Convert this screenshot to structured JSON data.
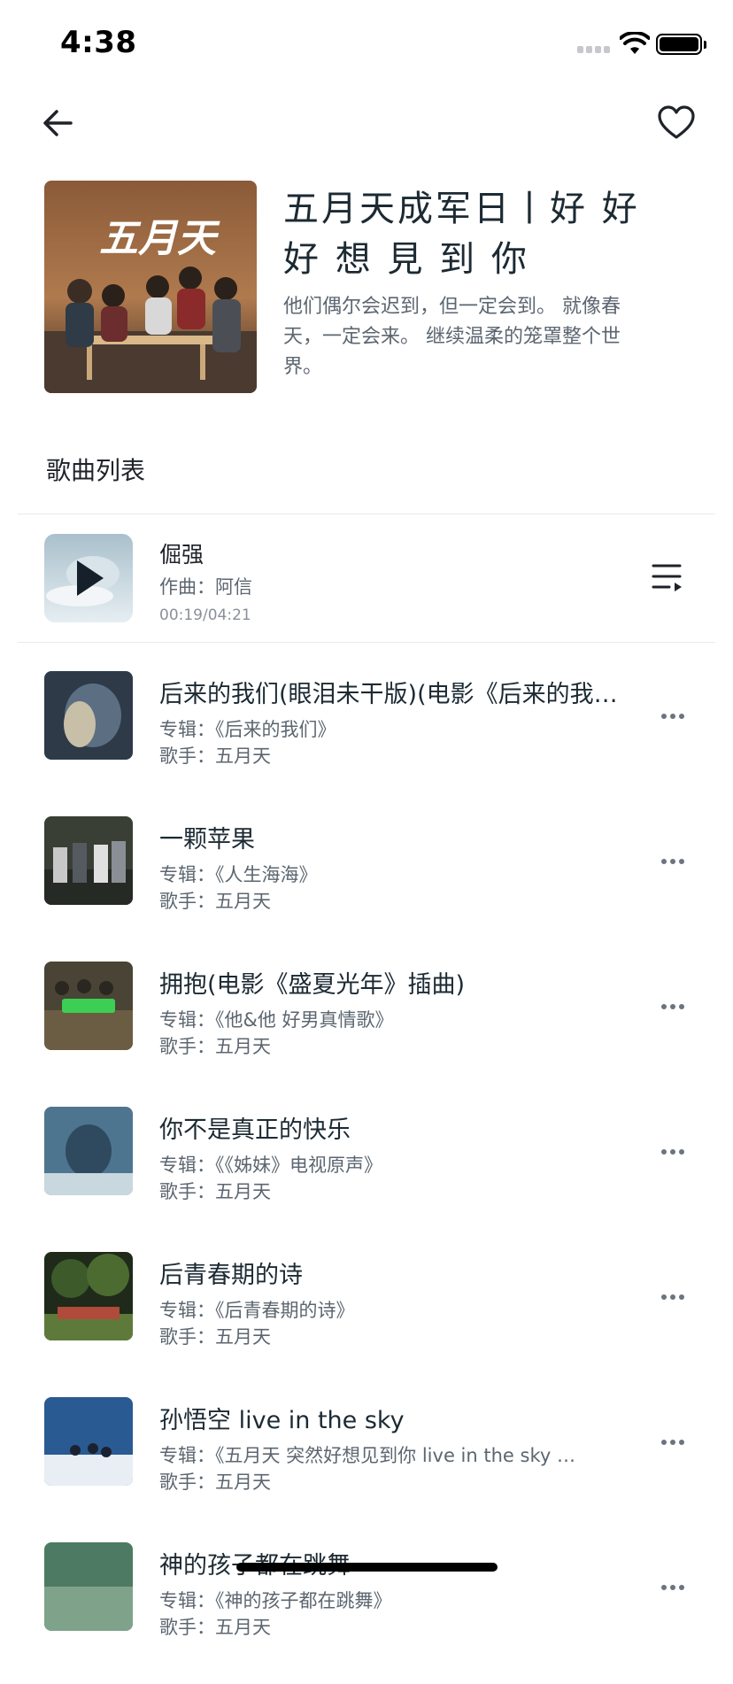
{
  "status_bar": {
    "time": "4:38"
  },
  "playlist": {
    "title": "五月天成军日丨好 好 好 想 見 到 你",
    "description": "他们偶尔会迟到，但一定会到。 就像春天，一定会来。 继续温柔的笼罩整个世界。",
    "cover_text": "五月天"
  },
  "list_heading": "歌曲列表",
  "now_playing": {
    "title": "倔强",
    "composer": "作曲：阿信",
    "progress": "00:19/04:21"
  },
  "songs": [
    {
      "title": "后来的我们(眼泪未干版)(电影《后来的我们》插曲)",
      "album": "专辑：《后来的我们》",
      "singer": "歌手：五月天"
    },
    {
      "title": "一颗苹果",
      "album": "专辑：《人生海海》",
      "singer": "歌手：五月天"
    },
    {
      "title": "拥抱(电影《盛夏光年》插曲)",
      "album": "专辑：《他&他 好男真情歌》",
      "singer": "歌手：五月天"
    },
    {
      "title": "你不是真正的快乐",
      "album": "专辑：《《姊妹》电视原声》",
      "singer": "歌手：五月天"
    },
    {
      "title": "后青春期的诗",
      "album": "专辑：《后青春期的诗》",
      "singer": "歌手：五月天"
    },
    {
      "title": "孙悟空 live in the sky",
      "album": "专辑：《五月天 突然好想见到你 live in the sky 演唱会》",
      "singer": "歌手：五月天"
    },
    {
      "title": "神的孩子都在跳舞",
      "album": "专辑：《神的孩子都在跳舞》",
      "singer": "歌手：五月天"
    }
  ],
  "icons": {
    "back": "arrow-left-icon",
    "favorite": "heart-icon",
    "queue": "playlist-icon",
    "more": "more-horizontal-icon",
    "play": "play-icon"
  },
  "colors": {
    "title": "#1c2a33",
    "secondary": "#5c6670",
    "divider": "#eaeaea"
  }
}
